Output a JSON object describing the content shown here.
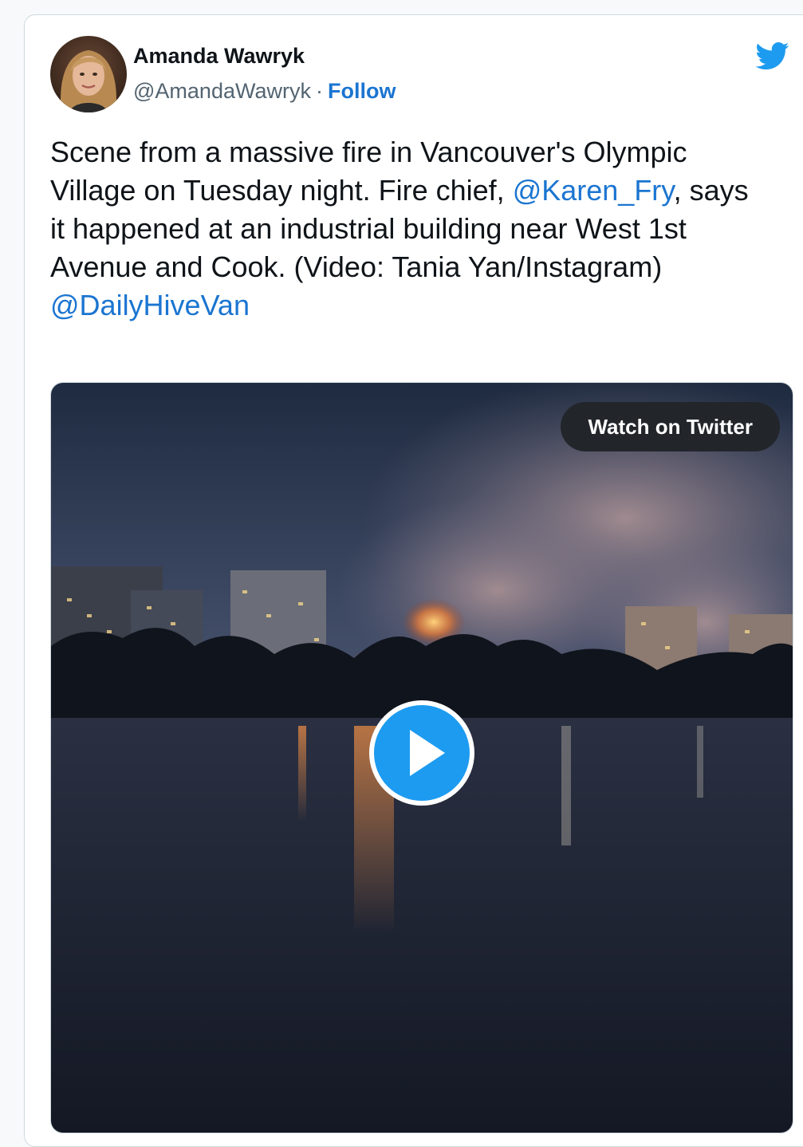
{
  "author": {
    "name": "Amanda Wawryk",
    "handle": "@AmandaWawryk",
    "separator": "·",
    "follow_label": "Follow",
    "avatar_icon": "avatar-photo"
  },
  "tweet": {
    "text_part1": "Scene from a massive fire in Vancouver's Olympic Village on Tuesday night. Fire chief,",
    "mention": "@Karen_Fry",
    "text_part2": ", says it happened at an industrial building near West 1st Avenue and Cook. (Video: Tania Yan/Instagram)",
    "tag_handle": "@DailyHiveVan"
  },
  "media": {
    "watch_label": "Watch on Twitter",
    "play_icon": "play-icon"
  },
  "colors": {
    "link": "#1b75d1",
    "twitter_blue": "#1d9bf0",
    "watch_button_bg": "#22262b"
  },
  "icons": {
    "brand": "twitter-bird-icon"
  }
}
